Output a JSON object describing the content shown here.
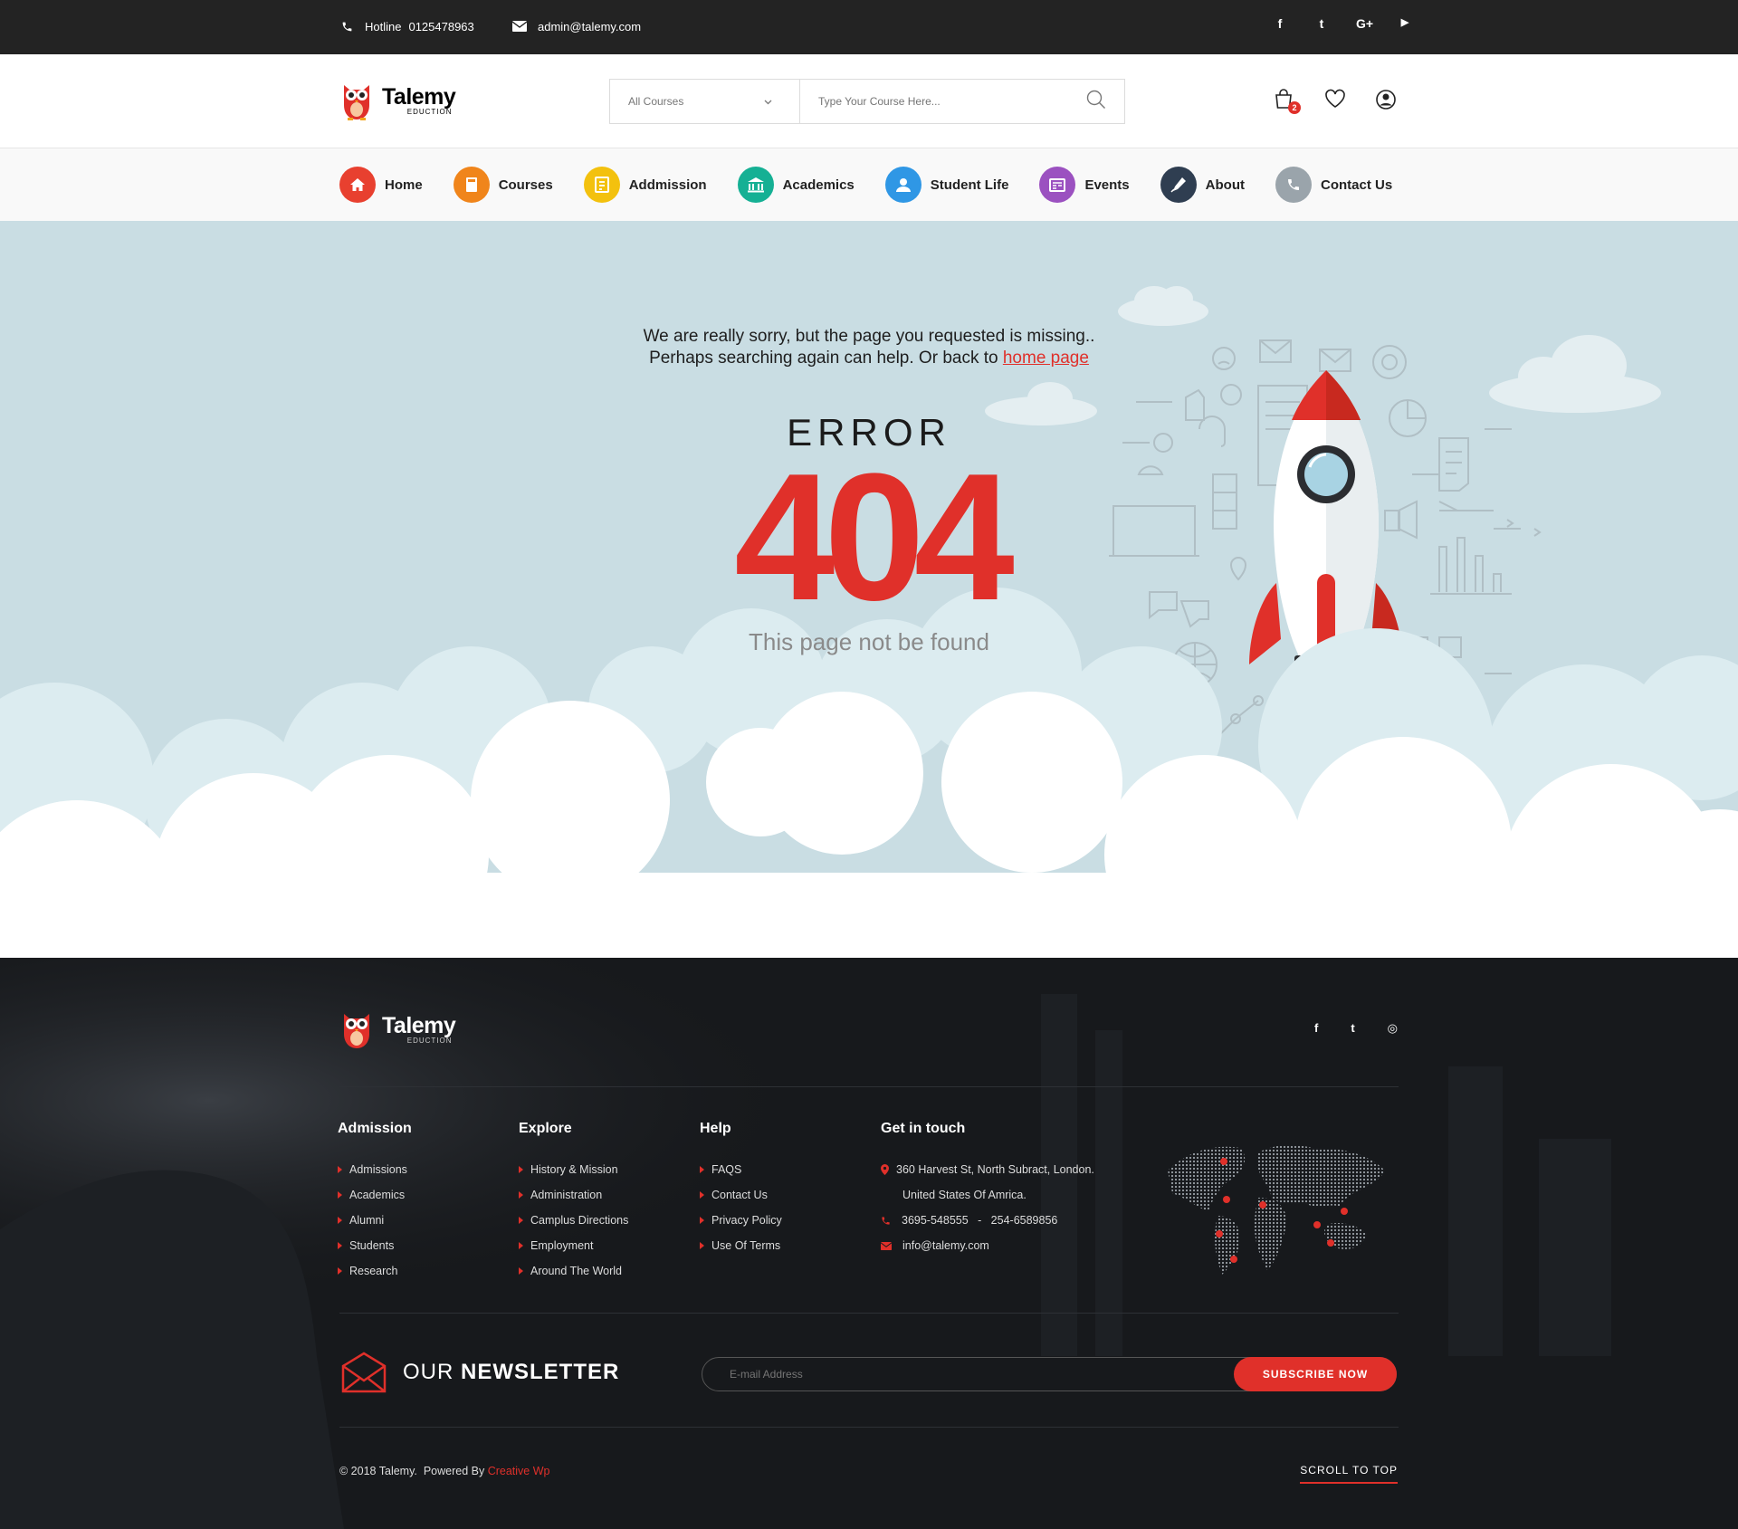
{
  "topbar": {
    "hotline_label": "Hotline",
    "hotline_number": "0125478963",
    "email": "admin@talemy.com",
    "social": [
      "f",
      "t",
      "G+",
      "▶"
    ]
  },
  "brand": {
    "name": "Talemy",
    "tagline": "EDUCTION"
  },
  "search": {
    "category": "All Courses",
    "placeholder": "Type Your Course Here..."
  },
  "header": {
    "cart_count": "2"
  },
  "nav": {
    "items": [
      {
        "label": "Home",
        "color": "#e8402f",
        "icon": "home-icon"
      },
      {
        "label": "Courses",
        "color": "#f0851b",
        "icon": "book-icon"
      },
      {
        "label": "Addmission",
        "color": "#f3c10e",
        "icon": "admission-icon"
      },
      {
        "label": "Academics",
        "color": "#15b094",
        "icon": "bank-icon"
      },
      {
        "label": "Student Life",
        "color": "#2f97e5",
        "icon": "user-icon"
      },
      {
        "label": "Events",
        "color": "#9b51c0",
        "icon": "calendar-icon"
      },
      {
        "label": "About",
        "color": "#2f3e51",
        "icon": "pen-icon"
      },
      {
        "label": "Contact Us",
        "color": "#9aa4ab",
        "icon": "phone-icon"
      }
    ]
  },
  "error": {
    "line1": "We are really sorry, but the page you requested is missing..",
    "line2": "Perhaps searching again can help. Or back to",
    "link": "home page",
    "title": "ERROR",
    "code": "404",
    "subtitle": "This page not be found"
  },
  "footer": {
    "social": [
      "f",
      "t",
      "◎"
    ],
    "columns": [
      {
        "title": "Admission",
        "items": [
          "Admissions",
          "Academics",
          "Alumni",
          "Students",
          "Research"
        ]
      },
      {
        "title": "Explore",
        "items": [
          "History & Mission",
          "Administration",
          "Camplus Directions",
          "Employment",
          "Around The World"
        ]
      },
      {
        "title": "Help",
        "items": [
          "FAQS",
          "Contact Us",
          "Privacy Policy",
          "Use Of Terms"
        ]
      }
    ],
    "contact": {
      "title": "Get in touch",
      "address1": "360 Harvest St, North Subract, London.",
      "address2": "United States Of Amrica.",
      "phone": "3695-548555   -   254-6589856",
      "email": "info@talemy.com"
    },
    "newsletter": {
      "title_light": "OUR",
      "title_bold": "NEWSLETTER",
      "placeholder": "E-mail Address",
      "button": "SUBSCRIBE NOW"
    },
    "copyright": "© 2018 Talemy.  Powered By",
    "powered": "Creative Wp",
    "scroll_top": "SCROLL TO TOP"
  }
}
